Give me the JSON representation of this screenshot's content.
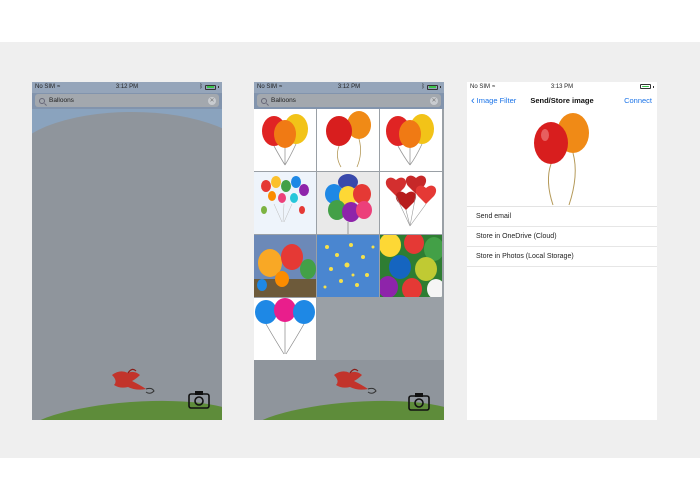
{
  "status": {
    "carrier": "No SIM",
    "time_1": "3:12 PM",
    "time_2": "3:12 PM",
    "time_3": "3:13 PM",
    "battery_level": 0.9,
    "battery_color": "#3bc24a"
  },
  "search": {
    "query": "Balloons",
    "clear_icon": "clear-icon",
    "search_icon": "search-icon"
  },
  "grid": {
    "images": [
      {
        "name": "balloons-red-yellow-orange"
      },
      {
        "name": "balloons-red-orange"
      },
      {
        "name": "balloons-red-yellow-orange-2"
      },
      {
        "name": "balloons-colorful-cluster"
      },
      {
        "name": "balloons-bunch-rainbow"
      },
      {
        "name": "balloons-red-hearts"
      },
      {
        "name": "hot-air-balloons"
      },
      {
        "name": "balloons-yellow-sky"
      },
      {
        "name": "balloons-many-colors-closeup"
      },
      {
        "name": "balloons-blue-pink-blue"
      }
    ]
  },
  "store_screen": {
    "back_label": "Image Filter",
    "title": "Send/Store image",
    "connect_label": "Connect",
    "options": [
      "Send email",
      "Store in OneDrive (Cloud)",
      "Store in Photos (Local Storage)"
    ]
  },
  "icons": {
    "camera": "camera-icon",
    "bird": "bird-logo",
    "back": "chevron-left-icon"
  },
  "colors": {
    "ios_blue": "#1a73e8",
    "map_grey": "#8f959c",
    "grass": "#5e8c3a"
  }
}
